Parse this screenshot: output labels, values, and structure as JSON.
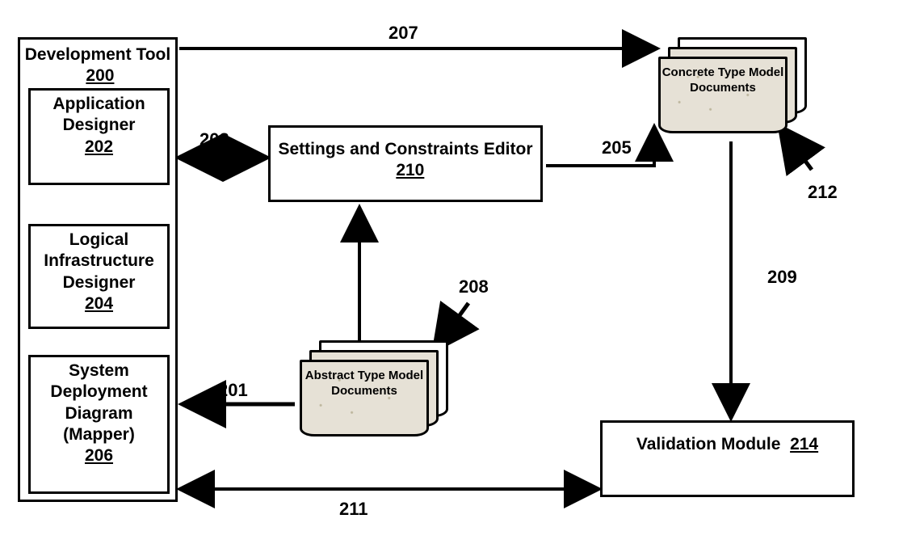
{
  "devtool": {
    "title": "Development Tool",
    "ref": "200",
    "application_designer": {
      "title": "Application Designer",
      "ref": "202"
    },
    "logical_infra_designer": {
      "title": "Logical Infrastructure Designer",
      "ref": "204"
    },
    "system_deployment": {
      "title": "System Deployment Diagram (Mapper)",
      "ref": "206"
    }
  },
  "settings_editor": {
    "title": "Settings and Constraints Editor",
    "ref": "210"
  },
  "validation_module": {
    "title": "Validation Module",
    "ref": "214"
  },
  "concrete_docs": {
    "title": "Concrete Type Model Documents"
  },
  "abstract_docs": {
    "title": "Abstract Type Model Documents"
  },
  "arrows": {
    "a201": "201",
    "a203": "203",
    "a205": "205",
    "a207": "207",
    "a208": "208",
    "a209": "209",
    "a211": "211",
    "a212": "212"
  }
}
